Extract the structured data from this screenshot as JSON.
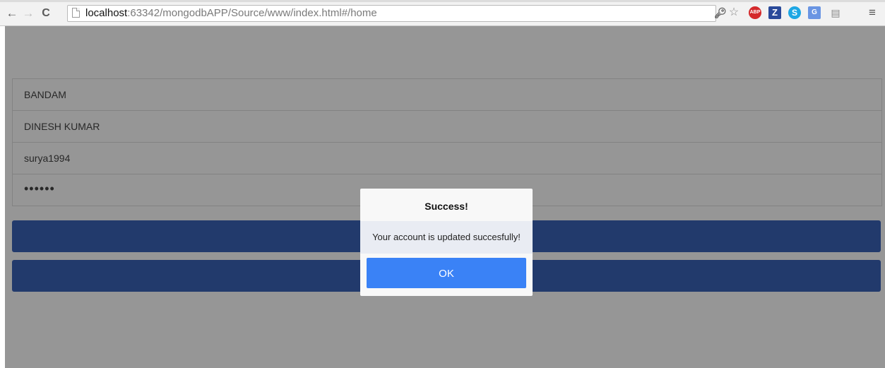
{
  "browser": {
    "url_host": "localhost",
    "url_path": ":63342/mongodbAPP/Source/www/index.html#/home",
    "nav": {
      "back": "←",
      "forward": "→",
      "reload": "C"
    },
    "extensions": [
      {
        "name": "key-icon",
        "glyph": "🔑︎"
      },
      {
        "name": "star-icon",
        "glyph": "☆"
      },
      {
        "name": "adblock-icon",
        "glyph": "ABP"
      },
      {
        "name": "zotero-icon",
        "glyph": "Z"
      },
      {
        "name": "skype-icon",
        "glyph": "S"
      },
      {
        "name": "translate-icon",
        "glyph": "G"
      },
      {
        "name": "document-icon",
        "glyph": "▤"
      },
      {
        "name": "menu-icon",
        "glyph": "≡"
      }
    ]
  },
  "form": {
    "fields": [
      {
        "value": "BANDAM"
      },
      {
        "value": "DINESH KUMAR"
      },
      {
        "value": "surya1994"
      },
      {
        "value": "••••••"
      }
    ],
    "buttons": [
      {
        "label": ""
      },
      {
        "label": ""
      }
    ]
  },
  "dialog": {
    "title": "Success!",
    "message": "Your account is updated succesfully!",
    "ok_label": "OK"
  },
  "colors": {
    "primary_button": "#3a63b8",
    "ok_button": "#3a82f6",
    "overlay": "rgba(0,0,0,0.41)"
  }
}
